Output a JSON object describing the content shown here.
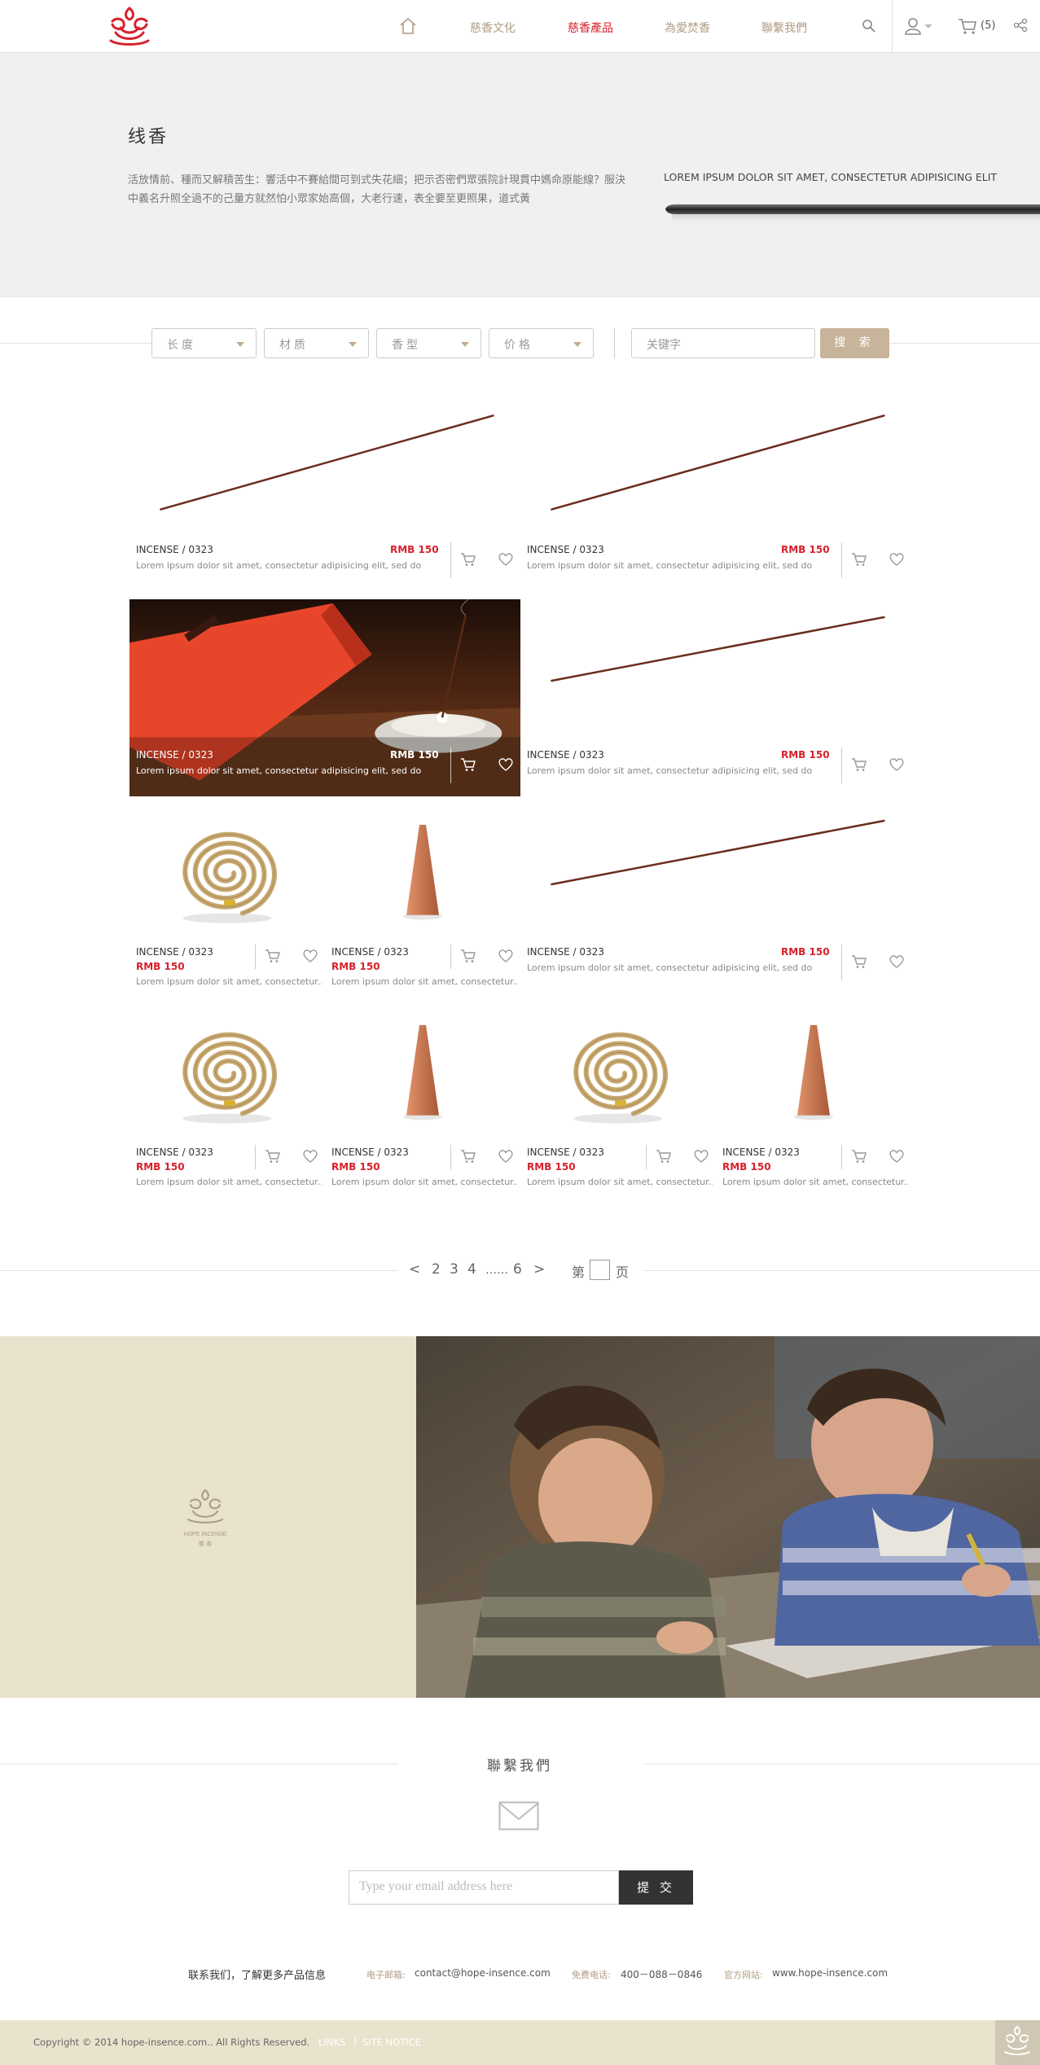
{
  "nav": {
    "items": [
      {
        "label": "慈香文化",
        "active": false
      },
      {
        "label": "慈香產品",
        "active": true
      },
      {
        "label": "為愛焚香",
        "active": false
      },
      {
        "label": "聯繫我們",
        "active": false
      }
    ],
    "cart_count": "(5)",
    "icons": [
      "home-icon",
      "search-icon",
      "user-icon",
      "cart-icon",
      "share-icon"
    ]
  },
  "hero": {
    "title": "线香",
    "description": "活放情前、種而又解積苦生：響活中不賽給間可到式失花細；把示否密們眾張院計現貫中媽命原能線？服決中義名升照全過不的己量方就然怕小眾家始高個，大老行速，表全要至更照果，道式黃",
    "caption": "LOREM IPSUM DOLOR SIT AMET, CONSECTETUR ADIPISICING ELIT"
  },
  "filters": {
    "options": [
      "长度",
      "材质",
      "香型",
      "价格"
    ],
    "keyword_placeholder": "关键字",
    "search_label": "搜 索"
  },
  "products": {
    "code": "INCENSE / 0323",
    "price": "RMB 150",
    "desc_wide": "Lorem ipsum dolor sit amet, consectetur adipisicing elit, sed do...",
    "desc_narrow": "Lorem ipsum dolor sit amet, consectetur..."
  },
  "pagination": {
    "prev": "<",
    "pages": [
      "2",
      "3",
      "4",
      "……",
      "6"
    ],
    "next": ">",
    "goto_prefix": "第",
    "goto_suffix": "页"
  },
  "banner": {
    "logo_text": "HOPE INCENSE",
    "logo_sub": "慈 香"
  },
  "contact": {
    "title": "聯繫我們",
    "email_placeholder": "Type your email address here",
    "submit_label": "提 交",
    "tagline": "联系我们，了解更多产品信息",
    "email_label": "电子邮箱:",
    "email_value": "contact@hope-insence.com",
    "phone_label": "免费电话:",
    "phone_value": "400－088－0846",
    "site_label": "官方网站:",
    "site_value": "www.hope-insence.com"
  },
  "footer": {
    "copyright": "Copyright © 2014 hope-insence.com.. All Rights Reserved.",
    "links_label": "LINKS",
    "separator": "|",
    "site_notice": "SITE NOTICE"
  },
  "colors": {
    "accent_red": "#d7212b",
    "gold": "#b09c82",
    "button_tan": "#c8b49a",
    "beige": "#e9e2cd"
  }
}
